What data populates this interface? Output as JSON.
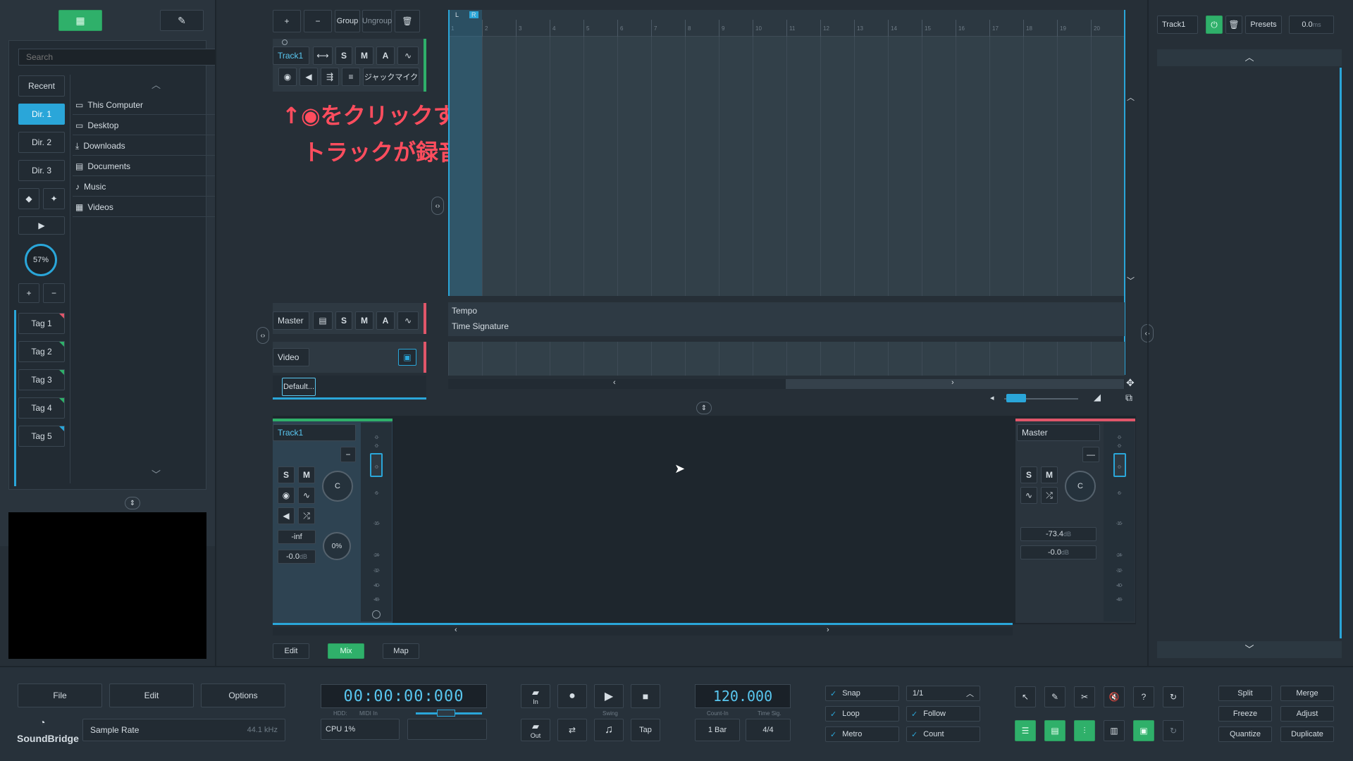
{
  "browser": {
    "search_placeholder": "Search",
    "side_buttons": [
      "Recent",
      "Dir. 1",
      "Dir. 2",
      "Dir. 3"
    ],
    "knob_value": "57%",
    "tags": [
      "Tag 1",
      "Tag 2",
      "Tag 3",
      "Tag 4",
      "Tag 5"
    ],
    "tag_colors": [
      "#e0566a",
      "#2fb06a",
      "#2fb06a",
      "#2fb06a",
      "#2aa6d9"
    ],
    "files": [
      "This Computer",
      "Desktop",
      "Downloads",
      "Documents",
      "Music",
      "Videos"
    ]
  },
  "tracks_header": {
    "group": "Group",
    "ungroup": "Ungroup"
  },
  "track1": {
    "name": "Track1",
    "s": "S",
    "m": "M",
    "a": "A",
    "input": "ジャックマイク"
  },
  "master": {
    "name": "Master",
    "s": "S",
    "m": "M",
    "a": "A"
  },
  "video": {
    "name": "Video",
    "default_tab": "Default..."
  },
  "annotation": {
    "line1": "↑◉をクリックすると、",
    "line2": "トラックが録音待機状態になる"
  },
  "timeline": {
    "ruler": [
      "1",
      "2",
      "3",
      "4",
      "5",
      "6",
      "7",
      "8",
      "9",
      "10",
      "11",
      "12",
      "13",
      "14",
      "15",
      "16",
      "17",
      "18",
      "19",
      "20"
    ],
    "loop_l": "L",
    "loop_r": "R"
  },
  "global_tracks": {
    "tempo": "Tempo",
    "time_signature": "Time Signature"
  },
  "right_panel": {
    "track": "Track1",
    "presets": "Presets",
    "delay": "0.0",
    "delay_unit": "ms"
  },
  "mixer": {
    "track1": {
      "name": "Track1",
      "s": "S",
      "m": "M",
      "pan": "C",
      "volume": "-inf",
      "gain": "-0.0",
      "gain_unit": "dB",
      "send": "0%"
    },
    "master": {
      "name": "Master",
      "s": "S",
      "m": "M",
      "pan": "C",
      "level": "-73.4",
      "level_unit": "dB",
      "gain": "-0.0",
      "gain_unit": "dB"
    },
    "scale": [
      "-0-",
      "-0-",
      "-0-",
      "-6-",
      "-16-",
      "-24-",
      "-32-",
      "-40-",
      "-48-"
    ]
  },
  "bottom_tabs": [
    "Edit",
    "Mix",
    "Map"
  ],
  "transport": {
    "menu": [
      "File",
      "Edit",
      "Options"
    ],
    "brand": "SoundBridge",
    "sample_rate_label": "Sample Rate",
    "sample_rate_value": "44.1 kHz",
    "time": "00:00:00:000",
    "hdd": "HDD:",
    "midi_in": "MIDI In",
    "cpu": "CPU 1%",
    "in": "In",
    "out": "Out",
    "swing": "Swing",
    "tap": "Tap",
    "tempo": "120.000",
    "count_in_label": "Count-In",
    "time_sig_label": "Time Sig.",
    "count_in": "1 Bar",
    "time_sig": "4/4",
    "snap": "Snap",
    "loop": "Loop",
    "metro": "Metro",
    "quant": "1/1",
    "follow": "Follow",
    "count": "Count",
    "edit_ops": [
      "Split",
      "Merge",
      "Freeze",
      "Adjust",
      "Quantize",
      "Duplicate"
    ]
  },
  "colors": {
    "accent": "#2aa6d9",
    "green": "#2fb06a",
    "red": "#e0566a",
    "annotation": "#ff4d5e"
  }
}
